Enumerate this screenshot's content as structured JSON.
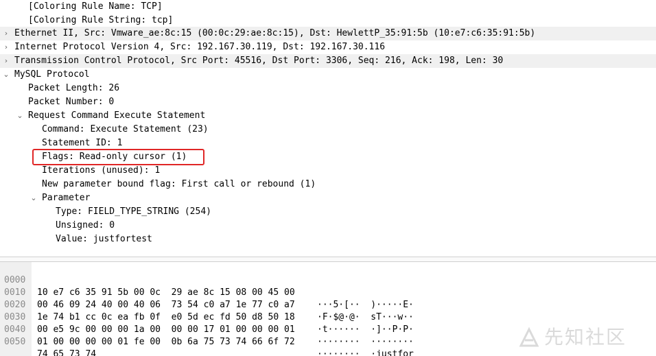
{
  "tree": {
    "rows": [
      {
        "text": "[Coloring Rule Name: TCP]",
        "toggle": ""
      },
      {
        "text": "[Coloring Rule String: tcp]",
        "toggle": ""
      },
      {
        "text": "Ethernet II, Src: Vmware_ae:8c:15 (00:0c:29:ae:8c:15), Dst: HewlettP_35:91:5b (10:e7:c6:35:91:5b)",
        "toggle": "›"
      },
      {
        "text": "Internet Protocol Version 4, Src: 192.167.30.119, Dst: 192.167.30.116",
        "toggle": "›"
      },
      {
        "text": "Transmission Control Protocol, Src Port: 45516, Dst Port: 3306, Seq: 216, Ack: 198, Len: 30",
        "toggle": "›"
      },
      {
        "text": "MySQL Protocol",
        "toggle": "⌄"
      },
      {
        "text": "Packet Length: 26",
        "toggle": ""
      },
      {
        "text": "Packet Number: 0",
        "toggle": ""
      },
      {
        "text": "Request Command Execute Statement",
        "toggle": "⌄"
      },
      {
        "text": "Command: Execute Statement (23)",
        "toggle": ""
      },
      {
        "text": "Statement ID: 1",
        "toggle": ""
      },
      {
        "text": "Flags: Read-only cursor (1)",
        "toggle": ""
      },
      {
        "text": "Iterations (unused): 1",
        "toggle": ""
      },
      {
        "text": "New parameter bound flag: First call or rebound (1)",
        "toggle": ""
      },
      {
        "text": "Parameter",
        "toggle": "⌄"
      },
      {
        "text": "Type: FIELD_TYPE_STRING (254)",
        "toggle": ""
      },
      {
        "text": "Unsigned: 0",
        "toggle": ""
      },
      {
        "text": "Value: justfortest",
        "toggle": ""
      }
    ]
  },
  "bytes": {
    "rows": [
      {
        "offset": "0000",
        "hex": "10 e7 c6 35 91 5b 00 0c  29 ae 8c 15 08 00 45 00",
        "ascii": "···5·[··  )·····E·"
      },
      {
        "offset": "0010",
        "hex": "00 46 09 24 40 00 40 06  73 54 c0 a7 1e 77 c0 a7",
        "ascii": "·F·$@·@·  sT···w··"
      },
      {
        "offset": "0020",
        "hex": "1e 74 b1 cc 0c ea fb 0f  e0 5d ec fd 50 d8 50 18",
        "ascii": "·t······  ·]··P·P·"
      },
      {
        "offset": "0030",
        "hex": "00 e5 9c 00 00 00 1a 00  00 00 17 01 00 00 00 01",
        "ascii": "········  ········"
      },
      {
        "offset": "0040",
        "hex": "01 00 00 00 00 01 fe 00  0b 6a 75 73 74 66 6f 72",
        "ascii": "········  ·justfor"
      },
      {
        "offset": "0050",
        "hex": "74 65 73 74",
        "ascii": "test"
      }
    ]
  },
  "watermark": {
    "text": "先知社区"
  }
}
